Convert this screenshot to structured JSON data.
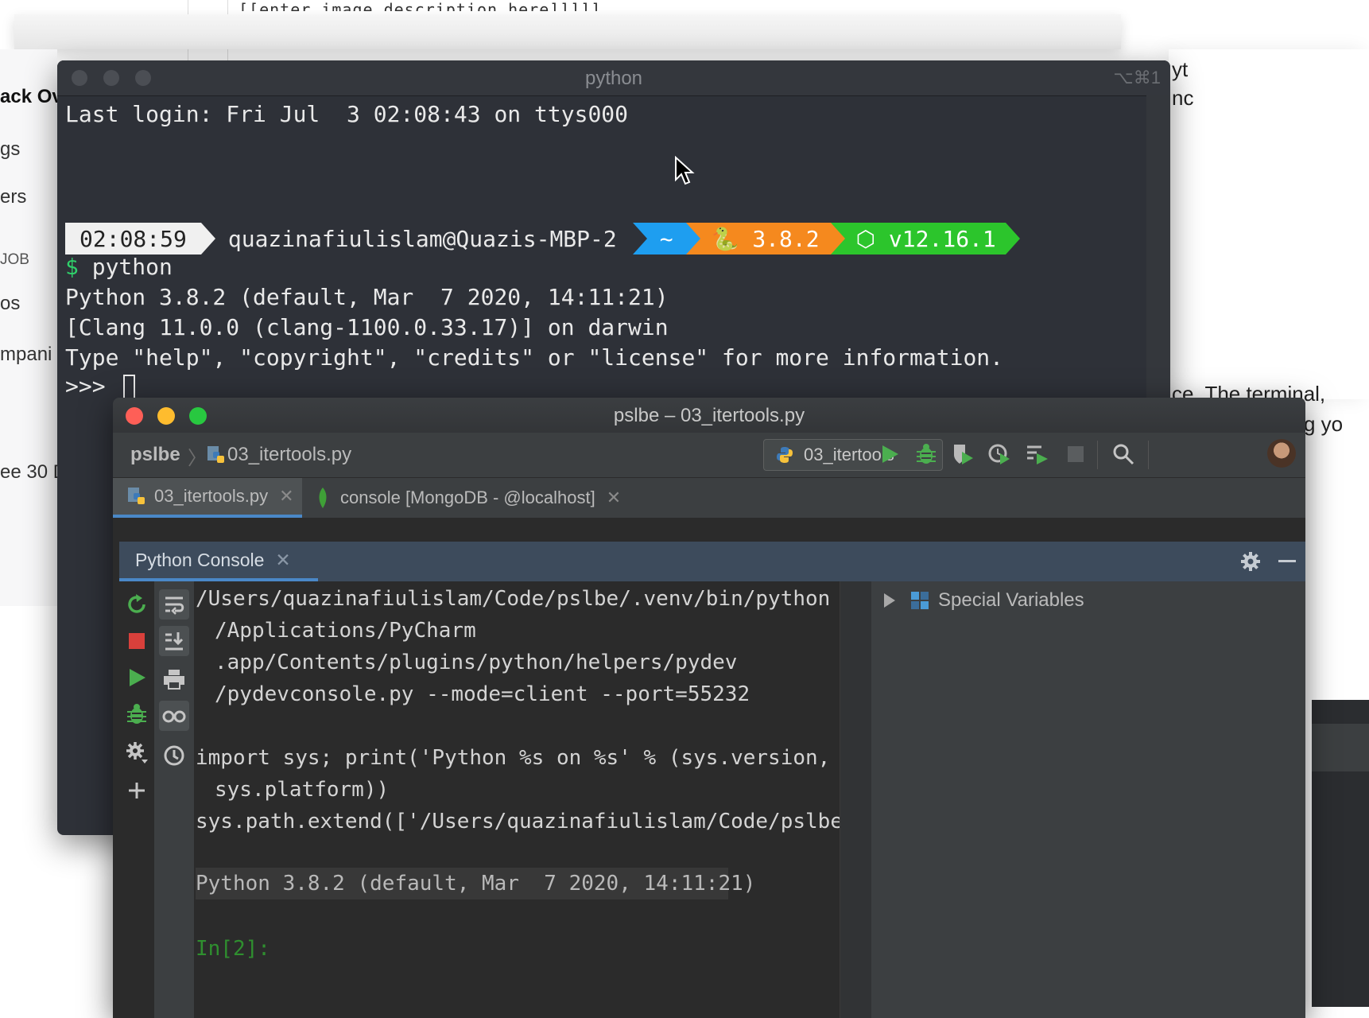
{
  "background": {
    "top_line": "[[enter image description here]]]]]",
    "sidebar": [
      "ack Ov",
      "gs",
      "ers",
      "JOB",
      "os",
      "mpani",
      "ee 30 D"
    ],
    "right_text": [
      "yt",
      "nc",
      "ce. The terminal,",
      "g yo"
    ]
  },
  "terminal": {
    "title": "python",
    "shortcut": "⌥⌘1",
    "last_login": "Last login: Fri Jul  3 02:08:43 on ttys000",
    "prompt": {
      "time": "02:08:59",
      "user": "quazinafiulislam@Quazis-MBP-2",
      "dir": "~",
      "python_version": "🐍 3.8.2",
      "node_version": "⬡ v12.16.1"
    },
    "command_symbol": "$",
    "command": "python",
    "output": [
      "Python 3.8.2 (default, Mar  7 2020, 14:11:21)",
      "[Clang 11.0.0 (clang-1100.0.33.17)] on darwin",
      "Type \"help\", \"copyright\", \"credits\" or \"license\" for more information."
    ],
    "repl_prompt": ">>>"
  },
  "pycharm": {
    "window_title": "pslbe – 03_itertools.py",
    "breadcrumb": {
      "project": "pslbe",
      "file": "03_itertools.py"
    },
    "run_config": "03_itertools",
    "editor_tabs": [
      {
        "label": "03_itertools.py",
        "active": true
      },
      {
        "label": "console [MongoDB - @localhost]",
        "active": false
      }
    ],
    "tool_window": {
      "title": "Python Console"
    },
    "console_lines": [
      "/Users/quazinafiulislam/Code/pslbe/.venv/bin/python",
      "/Applications/PyCharm",
      ".app/Contents/plugins/python/helpers/pydev",
      "/pydevconsole.py --mode=client --port=55232",
      "import sys; print('Python %s on %s' % (sys.version,",
      "sys.platform))",
      "sys.path.extend(['/Users/quazinafiulislam/Code/pslbe'])"
    ],
    "banner": "Python 3.8.2 (default, Mar  7 2020, 14:11:21)",
    "input_prompt": "In[2]:",
    "variables_root": "Special Variables"
  }
}
